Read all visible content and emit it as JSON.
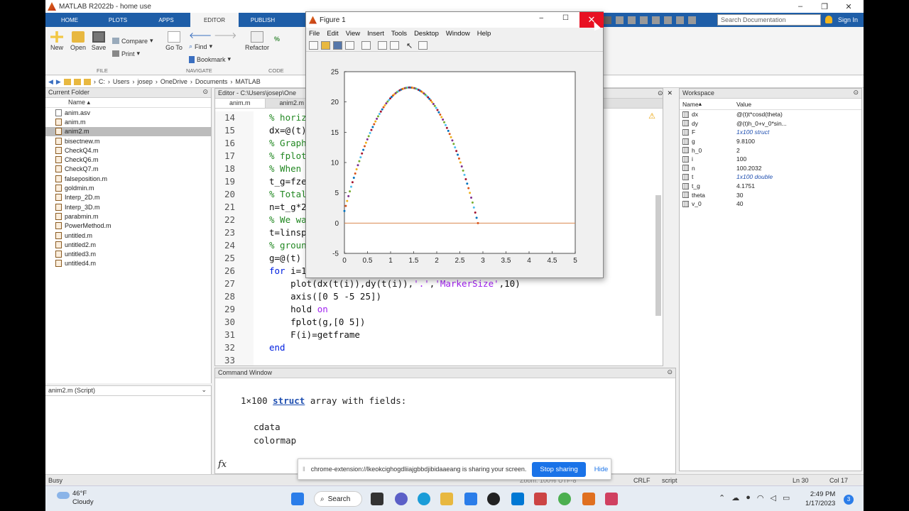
{
  "app": {
    "title": "MATLAB R2022b - home use"
  },
  "ribbon": {
    "tabs": [
      "HOME",
      "PLOTS",
      "APPS",
      "EDITOR",
      "PUBLISH"
    ],
    "active_tab": "EDITOR",
    "search_placeholder": "Search Documentation",
    "sign_in": "Sign In",
    "new": "New",
    "open": "Open",
    "save": "Save",
    "compare": "Compare",
    "print": "Print",
    "goto": "Go To",
    "find": "Find",
    "bookmark": "Bookmark",
    "refactor": "Refactor",
    "sections": [
      "FILE",
      "NAVIGATE",
      "CODE"
    ]
  },
  "path": [
    "C:",
    "Users",
    "josep",
    "OneDrive",
    "Documents",
    "MATLAB"
  ],
  "current_folder": {
    "title": "Current Folder",
    "column": "Name",
    "files": [
      "anim.asv",
      "anim.m",
      "anim2.m",
      "bisectnew.m",
      "CheckQ4.m",
      "CheckQ6.m",
      "CheckQ7.m",
      "falseposition.m",
      "goldmin.m",
      "Interp_2D.m",
      "Interp_3D.m",
      "parabmin.m",
      "PowerMethod.m",
      "untitled.m",
      "untitled2.m",
      "untitled3.m",
      "untitled4.m"
    ],
    "selected": "anim2.m",
    "detail": "anim2.m  (Script)"
  },
  "editor": {
    "title": "Editor - C:\\Users\\josep\\One",
    "tabs": [
      "anim.m",
      "anim2.m"
    ],
    "lines": [
      {
        "n": "14",
        "t": "% horiz"
      },
      {
        "n": "15",
        "t": "dx=@(t)"
      },
      {
        "n": "16",
        "t": "% Graph"
      },
      {
        "n": "17",
        "t": "% fplot"
      },
      {
        "n": "18",
        "t": "% When"
      },
      {
        "n": "19",
        "t": "t_g=fze"
      },
      {
        "n": "20",
        "t": "% Total"
      },
      {
        "n": "21",
        "t": "n=t_g*2"
      },
      {
        "n": "22",
        "t": "% We wa"
      },
      {
        "n": "23",
        "t": "t=linsp"
      },
      {
        "n": "24",
        "t": "% groun"
      },
      {
        "n": "25",
        "t": "g=@(t)"
      },
      {
        "n": "26",
        "t": "for i=1"
      },
      {
        "n": "27",
        "t": "    plot(dx(t(i)),dy(t(i)),'.','MarkerSize',10)"
      },
      {
        "n": "28",
        "t": "    axis([0 5 -5 25])"
      },
      {
        "n": "29",
        "t": "    hold on"
      },
      {
        "n": "30",
        "t": "    fplot(g,[0 5])"
      },
      {
        "n": "31",
        "t": "    F(i)=getframe"
      },
      {
        "n": "32",
        "t": "end"
      },
      {
        "n": "33",
        "t": ""
      }
    ]
  },
  "command_window": {
    "title": "Command Window",
    "line1": "1×100 ",
    "link": "struct",
    "line1b": " array with fields:",
    "field1": "cdata",
    "field2": "colormap",
    "prompt": "fx"
  },
  "workspace": {
    "title": "Workspace",
    "col_name": "Name",
    "col_value": "Value",
    "vars": [
      {
        "name": "dx",
        "value": "@(t)t*cosd(theta)"
      },
      {
        "name": "dy",
        "value": "@(t)h_0+v_0*sin..."
      },
      {
        "name": "F",
        "value": "1x100 struct"
      },
      {
        "name": "g",
        "value": "9.8100"
      },
      {
        "name": "h_0",
        "value": "2"
      },
      {
        "name": "i",
        "value": "100"
      },
      {
        "name": "n",
        "value": "100.2032"
      },
      {
        "name": "t",
        "value": "1x100 double"
      },
      {
        "name": "t_g",
        "value": "4.1751"
      },
      {
        "name": "theta",
        "value": "30"
      },
      {
        "name": "v_0",
        "value": "40"
      }
    ]
  },
  "status": {
    "left": "Busy",
    "zoom": "Zoom: 100%",
    "encoding": "UTF-8",
    "eol": "CRLF",
    "type": "script",
    "ln": "Ln  30",
    "col": "Col  17"
  },
  "sharing": {
    "text": "chrome-extension://lkeokcighogdliiajgbbdjibidaaeang is sharing your screen.",
    "stop": "Stop sharing",
    "hide": "Hide"
  },
  "figure": {
    "title": "Figure 1",
    "menu": [
      "File",
      "Edit",
      "View",
      "Insert",
      "Tools",
      "Desktop",
      "Window",
      "Help"
    ]
  },
  "chart_data": {
    "type": "scatter",
    "title": "",
    "xlabel": "",
    "ylabel": "",
    "xlim": [
      0,
      5
    ],
    "ylim": [
      -5,
      25
    ],
    "xticks": [
      "0",
      "0.5",
      "1",
      "1.5",
      "2",
      "2.5",
      "3",
      "3.5",
      "4",
      "4.5",
      "5"
    ],
    "yticks": [
      "-5",
      "0",
      "5",
      "10",
      "15",
      "20",
      "25"
    ],
    "trajectory": {
      "h0": 2,
      "v0": 40,
      "theta_deg": 30,
      "g": 9.81,
      "x_scale": 0.02,
      "y_scale": 0.0255,
      "t_max": 4.1751,
      "count": 100
    },
    "ground_line": {
      "y": 0,
      "x": [
        0,
        5
      ],
      "color": "#d9874f"
    },
    "colors": [
      "#0072bd",
      "#d95319",
      "#edb120",
      "#7e2f8e",
      "#77ac30",
      "#4dbeee",
      "#a2142f"
    ]
  },
  "taskbar": {
    "temp": "46°F",
    "weather": "Cloudy",
    "search": "Search",
    "time": "2:49 PM",
    "date": "1/17/2023",
    "notif": "3"
  }
}
